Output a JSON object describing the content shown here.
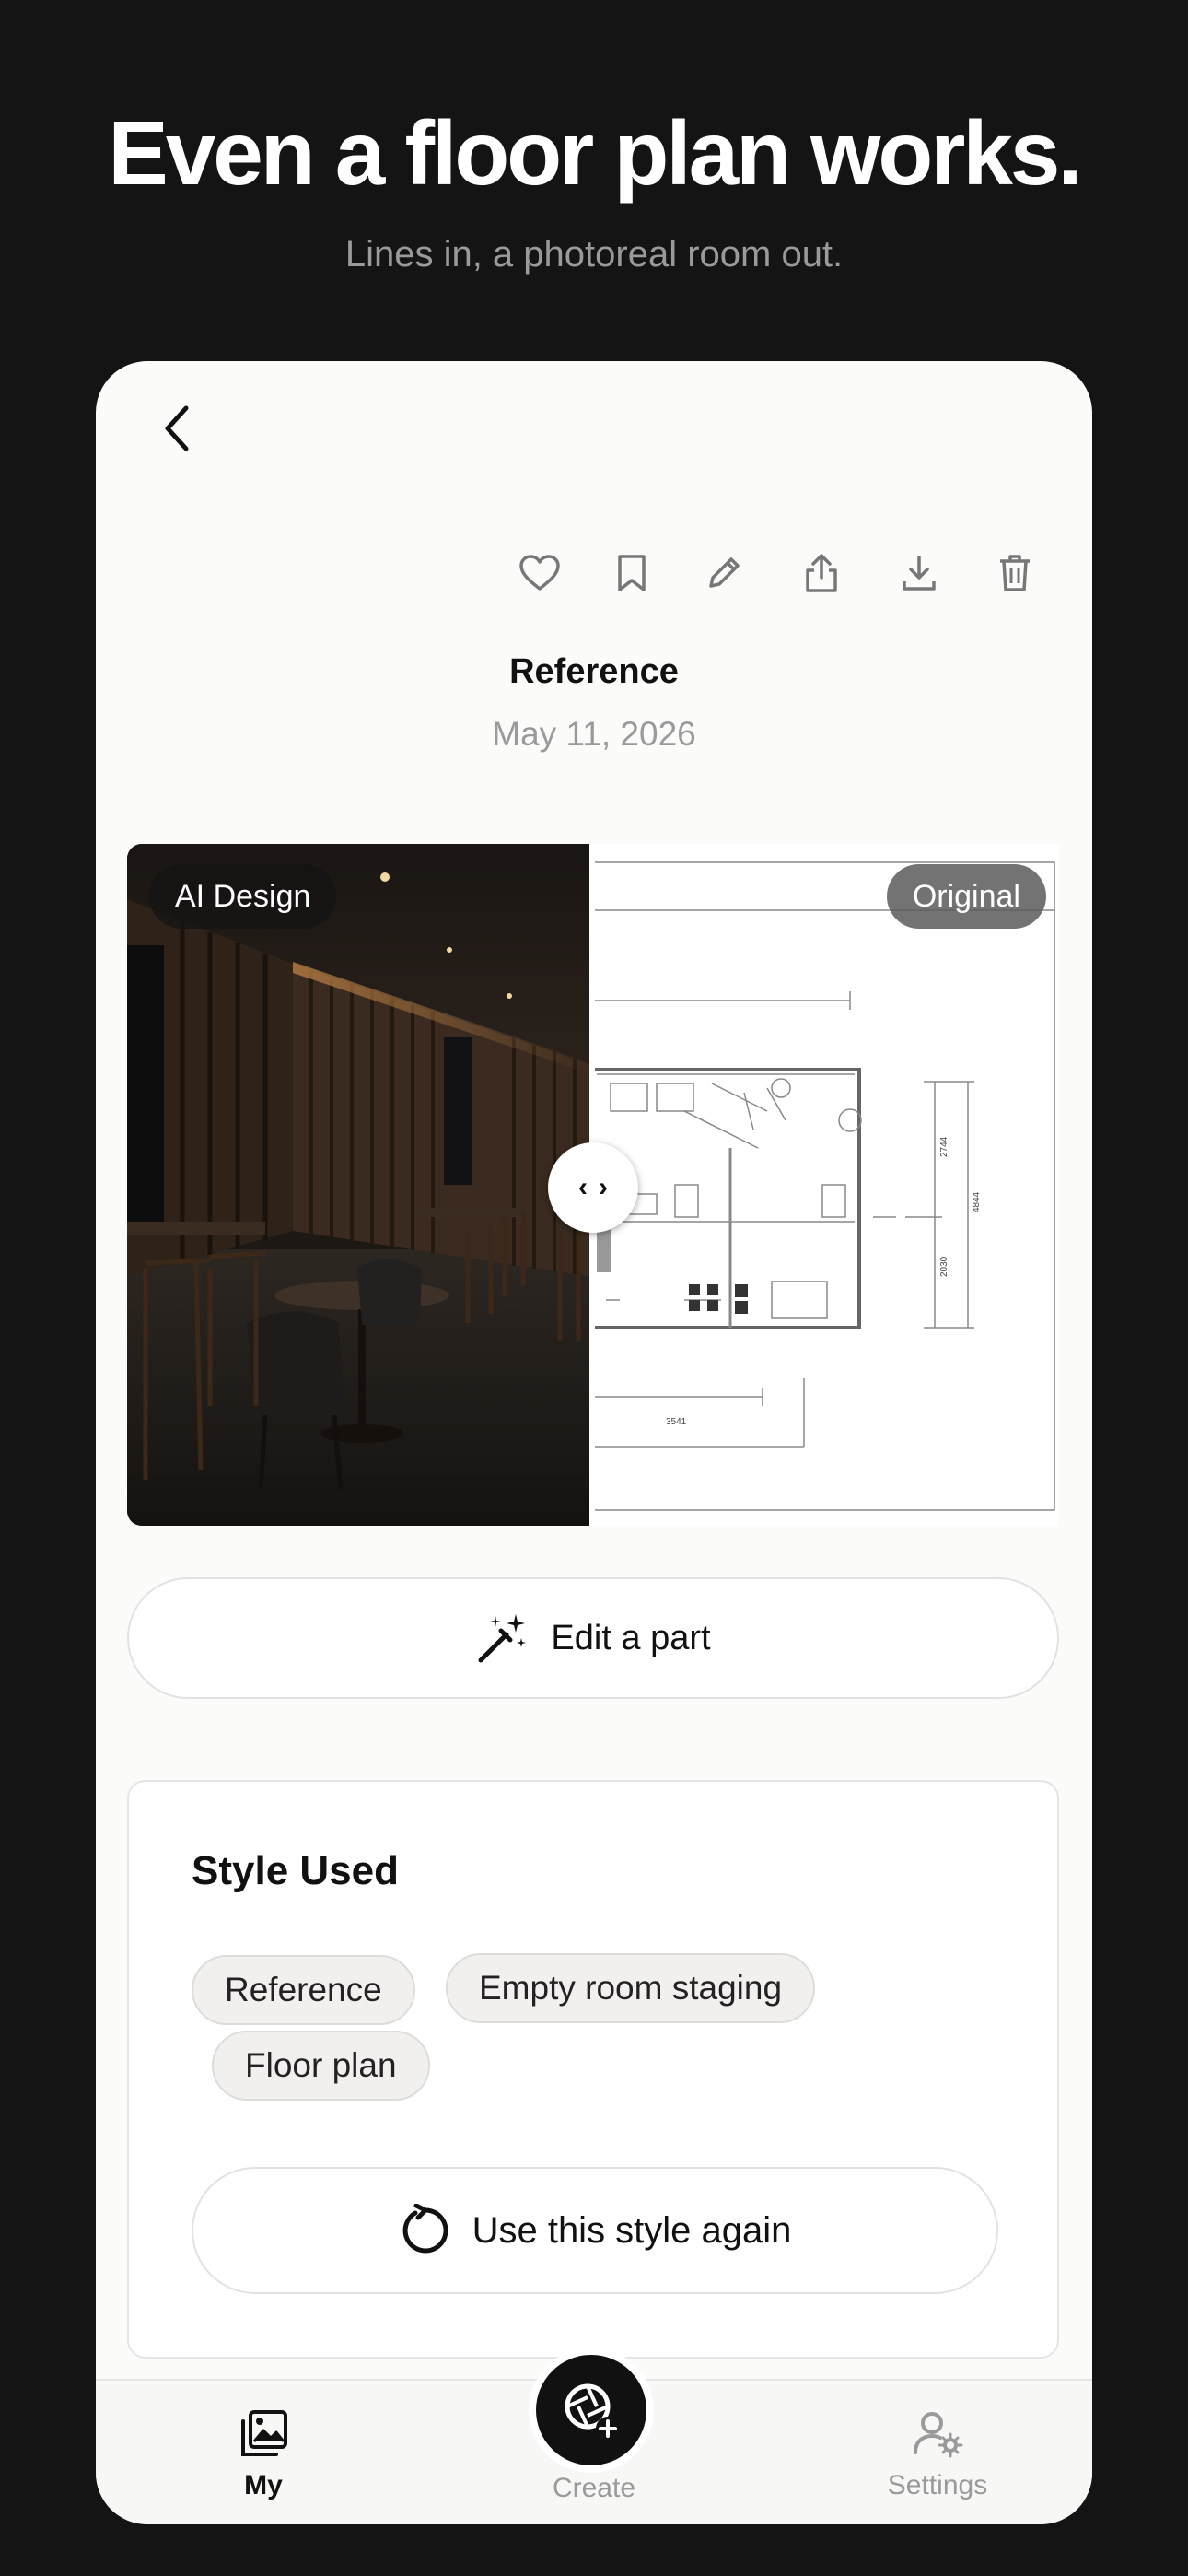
{
  "promo": {
    "headline": "Even a floor plan works.",
    "subline": "Lines in, a photoreal room out."
  },
  "header": {
    "back_icon": "chevron-left-icon",
    "actions": [
      {
        "name": "favorite",
        "icon": "heart-icon"
      },
      {
        "name": "bookmark",
        "icon": "bookmark-icon"
      },
      {
        "name": "edit",
        "icon": "pencil-icon"
      },
      {
        "name": "share",
        "icon": "share-icon"
      },
      {
        "name": "download",
        "icon": "download-icon"
      },
      {
        "name": "delete",
        "icon": "trash-icon"
      }
    ]
  },
  "design": {
    "title": "Reference",
    "date": "May 11, 2026"
  },
  "comparison": {
    "left_label": "AI Design",
    "right_label": "Original",
    "handle_left": "‹",
    "handle_right": "›",
    "plan_dims": {
      "width": "3541",
      "height_top": "2744",
      "height_bottom": "2030",
      "total": "4844"
    }
  },
  "edit_button": {
    "label": "Edit a part",
    "icon": "magic-wand-icon"
  },
  "style_used": {
    "title": "Style Used",
    "chips": [
      "Reference",
      "Empty room staging",
      "Floor plan"
    ],
    "again_label": "Use this style again",
    "again_icon": "rotate-icon"
  },
  "tabbar": {
    "tabs": [
      {
        "label": "My",
        "icon": "gallery-icon"
      },
      {
        "label": "Create",
        "icon": "camera-plus-icon"
      },
      {
        "label": "Settings",
        "icon": "user-gear-icon"
      }
    ]
  },
  "colors": {
    "background": "#141414",
    "surface": "#fbfbfa",
    "accent": "#111111",
    "muted": "#9a9a9a"
  }
}
